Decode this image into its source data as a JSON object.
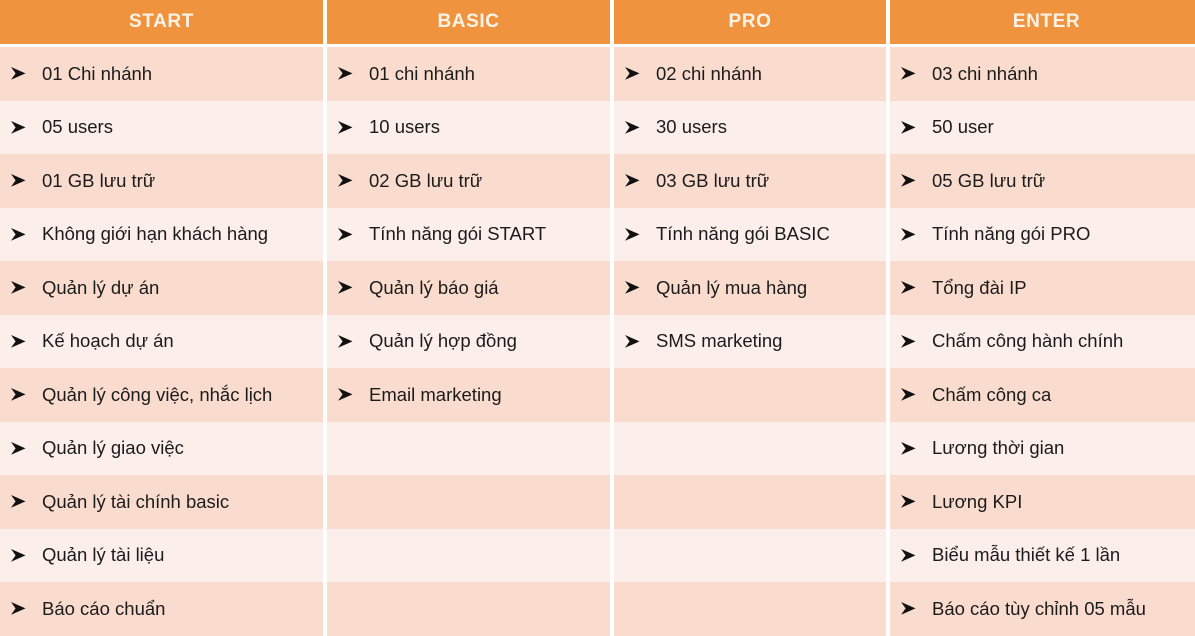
{
  "colors": {
    "header_bg": "#f0933f",
    "header_text": "#fdf3e7",
    "row_dark": "#fadccf",
    "row_light": "#fceeea",
    "body_text": "#1b1b1b",
    "page_bg": "#ffffff"
  },
  "columns": [
    {
      "header": "START",
      "items": [
        "01 Chi nhánh",
        "05 users",
        "01 GB lưu trữ",
        "Không giới hạn khách hàng",
        "Quản lý dự án",
        "Kế hoạch dự án",
        "Quản lý công việc, nhắc lịch",
        "Quản lý giao việc",
        "Quản lý tài chính basic",
        "Quản lý tài liệu",
        "Báo cáo chuẩn"
      ]
    },
    {
      "header": "BASIC",
      "items": [
        "01 chi nhánh",
        "10 users",
        "02 GB lưu trữ",
        "Tính năng gói START",
        "Quản lý báo giá",
        "Quản lý hợp đồng",
        "Email marketing",
        "",
        "",
        "",
        ""
      ]
    },
    {
      "header": "PRO",
      "items": [
        "02 chi nhánh",
        "30 users",
        "03 GB lưu trữ",
        "Tính năng gói BASIC",
        "Quản lý mua hàng",
        "SMS marketing",
        "",
        "",
        "",
        "",
        ""
      ]
    },
    {
      "header": "ENTER",
      "items": [
        "03 chi nhánh",
        "50 user",
        "05 GB lưu trữ",
        "Tính năng gói PRO",
        "Tổng đài IP",
        "Chấm công hành chính",
        "Chấm công ca",
        "Lương thời gian",
        "Lương KPI",
        "Biểu mẫu thiết kế 1 lần",
        "Báo cáo tùy chỉnh 05 mẫu"
      ]
    }
  ],
  "bullet_icon": "arrowhead-bullet-icon"
}
